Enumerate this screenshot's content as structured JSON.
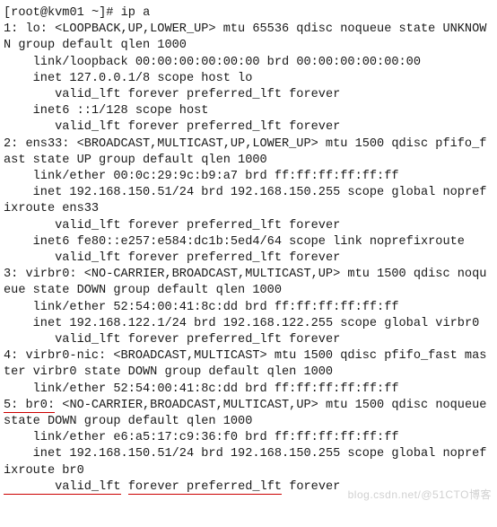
{
  "prompt": {
    "user": "root",
    "host": "kvm01",
    "cwd": "~",
    "symbol": "#",
    "command": "ip a"
  },
  "iface1": {
    "header": "1: lo: <LOOPBACK,UP,LOWER_UP> mtu 65536 qdisc noqueue state UNKNOWN group default qlen 1000",
    "link": "    link/loopback 00:00:00:00:00:00 brd 00:00:00:00:00:00",
    "inet": "    inet 127.0.0.1/8 scope host lo",
    "valid1": "       valid_lft forever preferred_lft forever",
    "inet6": "    inet6 ::1/128 scope host",
    "valid2": "       valid_lft forever preferred_lft forever"
  },
  "iface2": {
    "header": "2: ens33: <BROADCAST,MULTICAST,UP,LOWER_UP> mtu 1500 qdisc pfifo_fast state UP group default qlen 1000",
    "link": "    link/ether 00:0c:29:9c:b9:a7 brd ff:ff:ff:ff:ff:ff",
    "inet": "    inet 192.168.150.51/24 brd 192.168.150.255 scope global noprefixroute ens33",
    "valid1": "       valid_lft forever preferred_lft forever",
    "inet6": "    inet6 fe80::e257:e584:dc1b:5ed4/64 scope link noprefixroute",
    "valid2": "       valid_lft forever preferred_lft forever"
  },
  "iface3": {
    "header": "3: virbr0: <NO-CARRIER,BROADCAST,MULTICAST,UP> mtu 1500 qdisc noqueue state DOWN group default qlen 1000",
    "link": "    link/ether 52:54:00:41:8c:dd brd ff:ff:ff:ff:ff:ff",
    "inet": "    inet 192.168.122.1/24 brd 192.168.122.255 scope global virbr0",
    "valid1": "       valid_lft forever preferred_lft forever"
  },
  "iface4": {
    "header": "4: virbr0-nic: <BROADCAST,MULTICAST> mtu 1500 qdisc pfifo_fast master virbr0 state DOWN group default qlen 1000",
    "link": "    link/ether 52:54:00:41:8c:dd brd ff:ff:ff:ff:ff:ff"
  },
  "iface5": {
    "prefix": "5: ",
    "name": "br0:",
    "rest": " <NO-CARRIER,BROADCAST,MULTICAST,UP> mtu 1500 qdisc noqueue state DOWN group default qlen 1000",
    "link": "    link/ether e6:a5:17:c9:36:f0 brd ff:ff:ff:ff:ff:ff",
    "inet": "    inet 192.168.150.51/24 brd 192.168.150.255 scope global noprefixroute br0",
    "valid_a": "       valid_lft",
    "valid_b": "forever preferred_lft",
    "valid_c": "forever"
  },
  "watermark": "blog.csdn.net/@51CTO博客"
}
